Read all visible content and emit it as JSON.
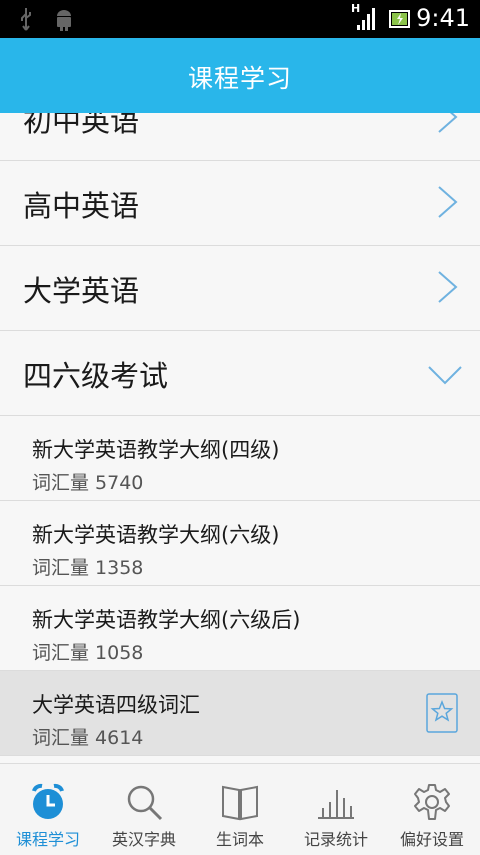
{
  "status_bar": {
    "time": "9:41",
    "network_type": "H",
    "icons": [
      "usb-icon",
      "android-icon",
      "signal-icon",
      "battery-icon"
    ]
  },
  "header": {
    "title": "课程学习"
  },
  "categories": [
    {
      "label": "初中英语",
      "state": "collapsed"
    },
    {
      "label": "高中英语",
      "state": "collapsed"
    },
    {
      "label": "大学英语",
      "state": "collapsed"
    },
    {
      "label": "四六级考试",
      "state": "expanded"
    }
  ],
  "books": [
    {
      "name": "新大学英语教学大纲(四级)",
      "count": "词汇量 5740"
    },
    {
      "name": "新大学英语教学大纲(六级)",
      "count": "词汇量 1358"
    },
    {
      "name": "新大学英语教学大纲(六级后)",
      "count": "词汇量 1058"
    },
    {
      "name": "大学英语四级词汇",
      "count": "词汇量 4614",
      "selected": true,
      "icon": "star-bookmark-icon"
    }
  ],
  "tabs": [
    {
      "label": "课程学习",
      "icon": "alarm-clock-icon",
      "active": true
    },
    {
      "label": "英汉字典",
      "icon": "search-icon"
    },
    {
      "label": "生词本",
      "icon": "book-icon"
    },
    {
      "label": "记录统计",
      "icon": "bar-chart-icon"
    },
    {
      "label": "偏好设置",
      "icon": "gear-icon"
    }
  ],
  "colors": {
    "accent": "#29b6ea",
    "tab_active": "#1e8fd6",
    "arrow": "#6fb2e0"
  }
}
